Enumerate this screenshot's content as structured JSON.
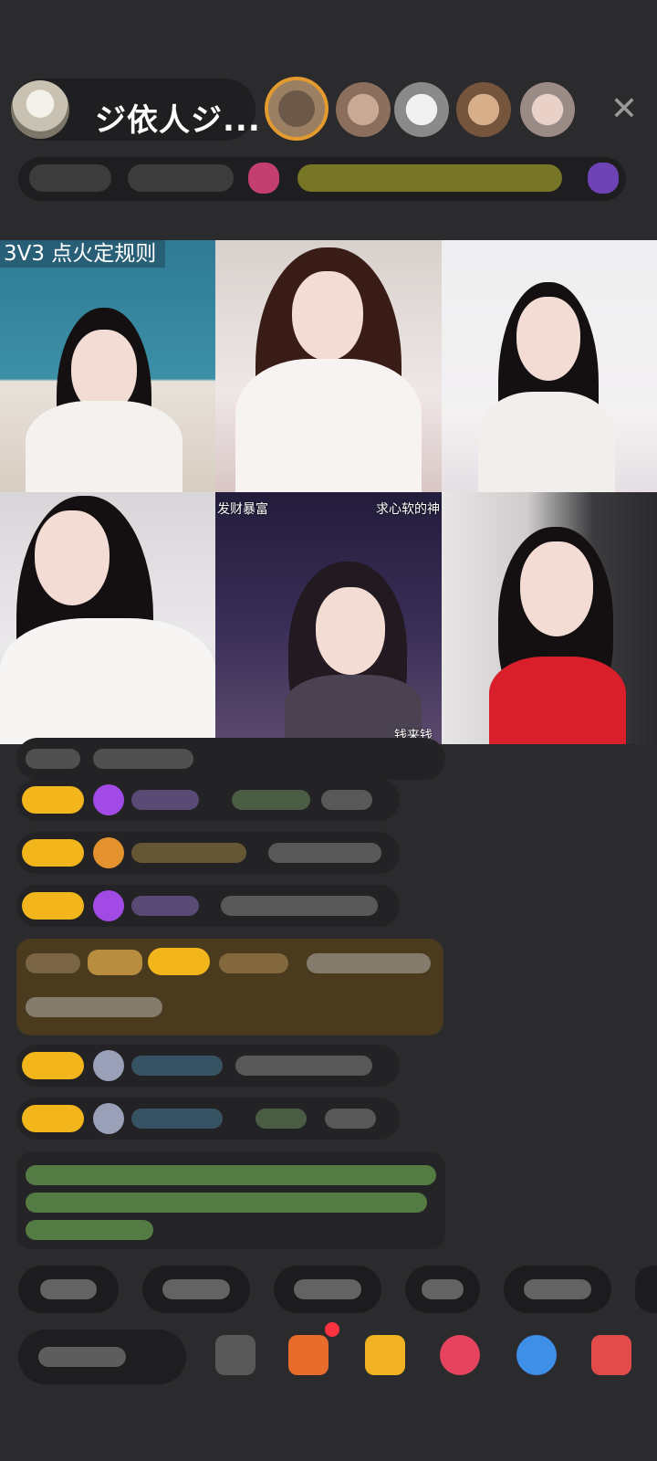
{
  "header": {
    "host_name": "ジ依人ジ...",
    "close_symbol": "✕"
  },
  "grid": {
    "room_rule": "3V3  点火定规则",
    "tags": {
      "top_left": "发财暴富",
      "top_right": "求心软的神",
      "bottom": "钱来钱"
    }
  },
  "colors": {
    "badge": "#f2b61c",
    "background": "#2b2b2d",
    "highlight_frame": "#e39b2f",
    "notification": "#ff3340"
  },
  "icons": {
    "close": "close-icon",
    "gift": "gift-icon",
    "game": "game-icon",
    "message": "message-icon",
    "share": "share-icon"
  }
}
